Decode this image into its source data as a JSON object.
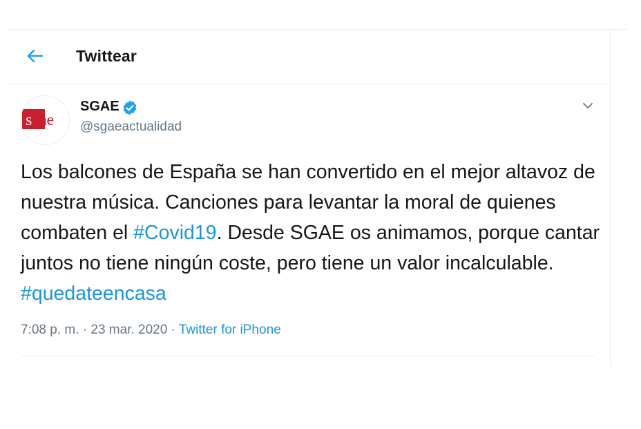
{
  "header": {
    "title": "Twittear"
  },
  "author": {
    "name": "SGAE",
    "handle": "@sgaeactualidad",
    "logo_text": "sgae",
    "verified": true
  },
  "tweet": {
    "text_segments": [
      {
        "text": "Los balcones de España se han convertido en el mejor altavoz de nuestra música. Canciones para levantar la moral de quienes combaten el ",
        "type": "text"
      },
      {
        "text": "#Covid19",
        "type": "hashtag"
      },
      {
        "text": ". Desde SGAE os animamos, porque cantar juntos no tiene ningún coste, pero tiene un valor incalculable. ",
        "type": "text"
      },
      {
        "text": "#quedateencasa",
        "type": "hashtag"
      }
    ]
  },
  "meta": {
    "time": "7:08 p. m.",
    "separator1": "·",
    "date": "23 mar. 2020",
    "separator2": "·",
    "source": "Twitter for iPhone"
  },
  "colors": {
    "accent": "#1b95e0",
    "brand_red": "#c8202f",
    "muted": "#657786",
    "verified": "#1da1f2"
  },
  "icons": {
    "back": "arrow-left-icon",
    "verified": "verified-badge-icon",
    "more": "chevron-down-icon"
  }
}
